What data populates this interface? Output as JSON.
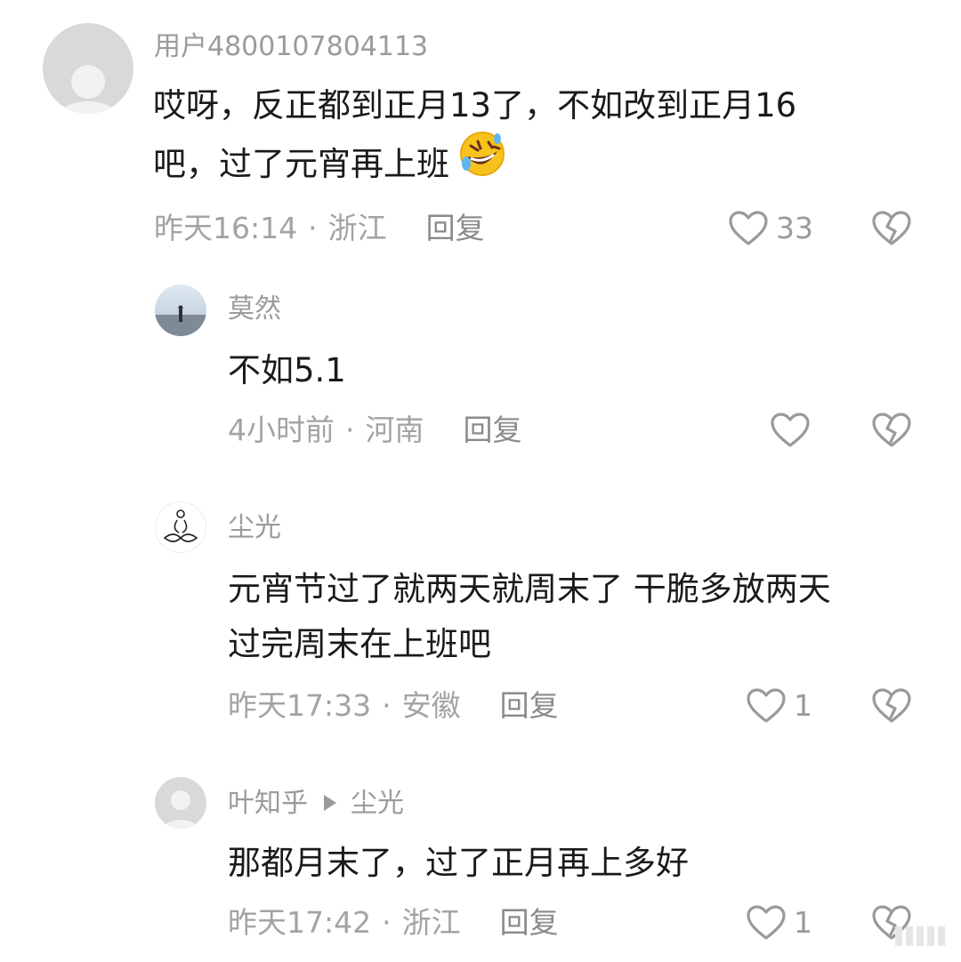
{
  "comments": [
    {
      "username": "用户4800107804113",
      "content_lines": [
        "哎呀，反正都到正月13了，不如改到正月16",
        "吧，过了元宵再上班"
      ],
      "emoji": "rofl-emoji",
      "time": "昨天16:14",
      "location": "浙江",
      "reply": "回复",
      "likes": "33"
    },
    {
      "username": "莫然",
      "content_lines": [
        "不如5.1"
      ],
      "time": "4小时前",
      "location": "河南",
      "reply": "回复",
      "likes": ""
    },
    {
      "username": "尘光",
      "content_lines": [
        "元宵节过了就两天就周末了 干脆多放两天",
        "过完周末在上班吧"
      ],
      "time": "昨天17:33",
      "location": "安徽",
      "reply": "回复",
      "likes": "1"
    },
    {
      "username": "叶知乎",
      "reply_to": "尘光",
      "content_lines": [
        "那都月末了，过了正月再上多好"
      ],
      "time": "昨天17:42",
      "location": "浙江",
      "reply": "回复",
      "likes": "1"
    }
  ],
  "separator": "·",
  "icons": {
    "like": "heart-outline-icon",
    "dislike": "broken-heart-icon"
  },
  "colors": {
    "text": "#1a1a1a",
    "meta": "#a3a3a3",
    "icon": "#9a9a9a"
  }
}
